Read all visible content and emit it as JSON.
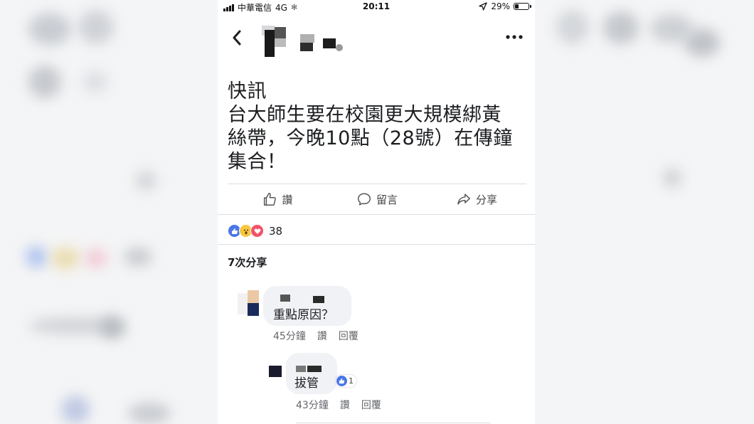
{
  "status_bar": {
    "carrier": "中華電信",
    "network": "4G",
    "time": "20:11",
    "battery": "29%"
  },
  "post": {
    "lines": [
      "快訊",
      "台大師生要在校園更大規模綁黃",
      "絲帶，今晚10點（28號）在傳鐘",
      "集合！"
    ]
  },
  "actions": {
    "like": "讚",
    "comment": "留言",
    "share": "分享"
  },
  "reactions": {
    "count": "38",
    "icons": [
      "like-icon",
      "wow-icon",
      "love-icon"
    ]
  },
  "shares": "7次分享",
  "comments": [
    {
      "text": "重點原因？",
      "time": "45分鐘",
      "like_label": "讚",
      "reply_label": "回覆"
    },
    {
      "text": "拔管",
      "time": "43分鐘",
      "like_label": "讚",
      "reply_label": "回覆",
      "like_count": "1"
    }
  ],
  "colors": {
    "like_blue": "#4a76e8",
    "text": "#1c1e21",
    "meta": "#65676b",
    "bubble": "#f0f2f5"
  }
}
